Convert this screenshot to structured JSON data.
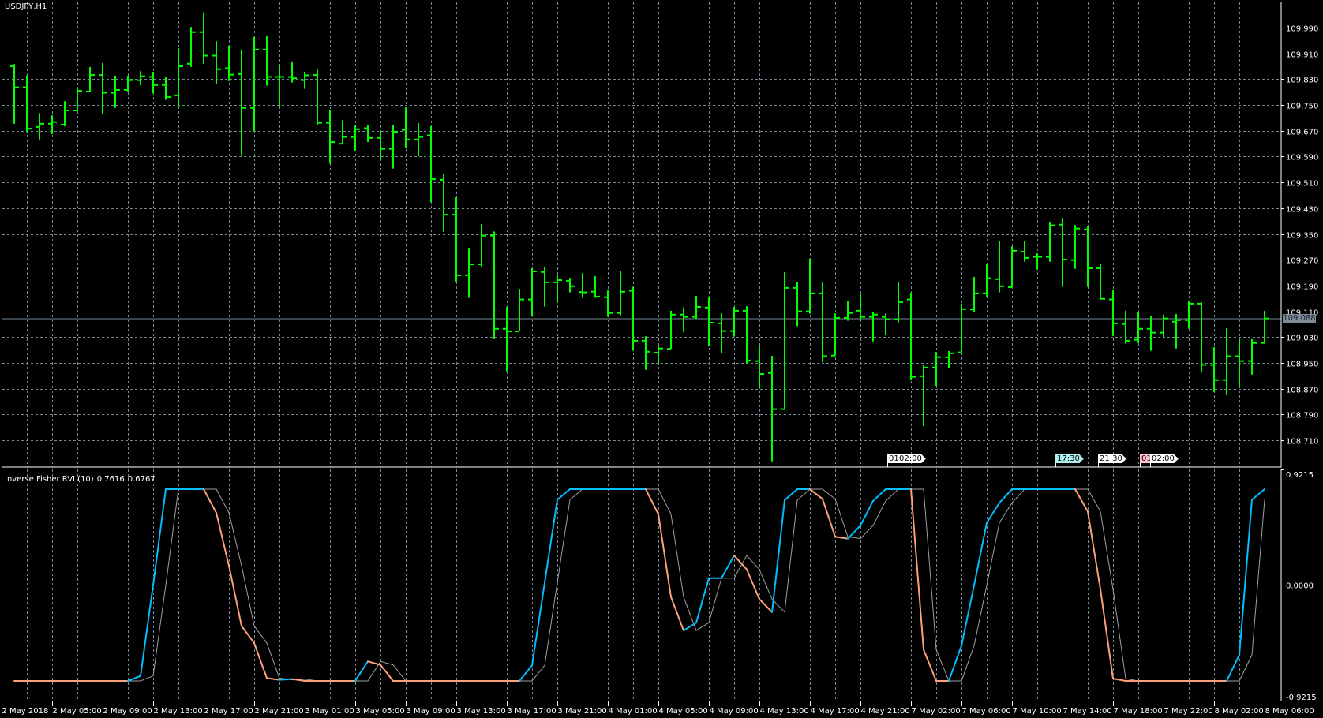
{
  "header": {
    "title": "USDJPY,H1"
  },
  "indicator": {
    "name": "Inverse Fisher RVI (10)",
    "value_main": "0.7616",
    "value_signal": "0.6767"
  },
  "current_price": "109.088",
  "colors": {
    "background": "#000000",
    "bars": "#00FF00",
    "grid": "#778899",
    "main_up": "#00BFFF",
    "main_down": "#FFA07A",
    "signal": "#A0A0A0",
    "axis": "#FFFFFF"
  },
  "markers": [
    {
      "label": "01:",
      "bg": "#FFFFFF"
    },
    {
      "label": "02:00",
      "bg": "#FFFFFF"
    },
    {
      "label": "17:30",
      "bg": "#AFEEEE"
    },
    {
      "label": "21:30",
      "bg": "#FFFFFF"
    },
    {
      "label": "01:",
      "bg": "#FFC0CB"
    },
    {
      "label": "02:00",
      "bg": "#FFFFFF"
    }
  ],
  "chart_data": [
    {
      "type": "ohlc",
      "title": "USDJPY,H1",
      "ylim": [
        108.655,
        110.08
      ],
      "price_ticks": [
        "109.990",
        "109.910",
        "109.830",
        "109.750",
        "109.670",
        "109.590",
        "109.510",
        "109.430",
        "109.350",
        "109.270",
        "109.190",
        "109.110",
        "109.030",
        "108.950",
        "108.870",
        "108.790",
        "108.710"
      ],
      "time_labels": [
        "2 May 2018",
        "2 May 05:00",
        "2 May 09:00",
        "2 May 13:00",
        "2 May 17:00",
        "2 May 21:00",
        "3 May 01:00",
        "3 May 05:00",
        "3 May 09:00",
        "3 May 13:00",
        "3 May 17:00",
        "3 May 21:00",
        "4 May 01:00",
        "4 May 05:00",
        "4 May 09:00",
        "4 May 13:00",
        "4 May 17:00",
        "4 May 21:00",
        "7 May 02:00",
        "7 May 06:00",
        "7 May 10:00",
        "7 May 14:00",
        "7 May 18:00",
        "7 May 22:00",
        "8 May 02:00",
        "8 May 06:00"
      ],
      "grid": true,
      "ohlc_fields": [
        "open",
        "high",
        "low",
        "close"
      ],
      "bars": [
        [
          109.87,
          109.877,
          109.692,
          109.805
        ],
        [
          109.805,
          109.842,
          109.666,
          109.677
        ],
        [
          109.682,
          109.725,
          109.643,
          109.692
        ],
        [
          109.692,
          109.718,
          109.66,
          109.697
        ],
        [
          109.689,
          109.762,
          109.684,
          109.733
        ],
        [
          109.733,
          109.806,
          109.731,
          109.794
        ],
        [
          109.792,
          109.868,
          109.79,
          109.843
        ],
        [
          109.843,
          109.88,
          109.723,
          109.788
        ],
        [
          109.788,
          109.841,
          109.741,
          109.797
        ],
        [
          109.797,
          109.841,
          109.79,
          109.827
        ],
        [
          109.827,
          109.855,
          109.812,
          109.839
        ],
        [
          109.837,
          109.853,
          109.786,
          109.812
        ],
        [
          109.812,
          109.838,
          109.766,
          109.775
        ],
        [
          109.78,
          109.926,
          109.741,
          109.87
        ],
        [
          109.878,
          109.992,
          109.868,
          109.976
        ],
        [
          109.976,
          110.037,
          109.877,
          109.903
        ],
        [
          109.903,
          109.948,
          109.815,
          109.861
        ],
        [
          109.864,
          109.934,
          109.824,
          109.844
        ],
        [
          109.846,
          109.922,
          109.592,
          109.741
        ],
        [
          109.741,
          109.961,
          109.668,
          109.922
        ],
        [
          109.922,
          109.966,
          109.81,
          109.837
        ],
        [
          109.837,
          109.875,
          109.745,
          109.837
        ],
        [
          109.837,
          109.885,
          109.82,
          109.833
        ],
        [
          109.827,
          109.853,
          109.8,
          109.842
        ],
        [
          109.843,
          109.86,
          109.687,
          109.695
        ],
        [
          109.695,
          109.735,
          109.568,
          109.635
        ],
        [
          109.63,
          109.703,
          109.63,
          109.651
        ],
        [
          109.651,
          109.686,
          109.609,
          109.675
        ],
        [
          109.678,
          109.689,
          109.635,
          109.648
        ],
        [
          109.648,
          109.67,
          109.58,
          109.614
        ],
        [
          109.614,
          109.689,
          109.553,
          109.667
        ],
        [
          109.673,
          109.745,
          109.616,
          109.643
        ],
        [
          109.643,
          109.694,
          109.591,
          109.651
        ],
        [
          109.656,
          109.684,
          109.449,
          109.52
        ],
        [
          109.518,
          109.537,
          109.357,
          109.41
        ],
        [
          109.41,
          109.464,
          109.202,
          109.222
        ],
        [
          109.222,
          109.307,
          109.152,
          109.256
        ],
        [
          109.256,
          109.381,
          109.246,
          109.345
        ],
        [
          109.345,
          109.358,
          109.024,
          109.056
        ],
        [
          109.056,
          109.124,
          108.924,
          109.048
        ],
        [
          109.048,
          109.18,
          109.048,
          109.147
        ],
        [
          109.147,
          109.244,
          109.097,
          109.234
        ],
        [
          109.232,
          109.248,
          109.125,
          109.2
        ],
        [
          109.2,
          109.224,
          109.137,
          109.207
        ],
        [
          109.205,
          109.214,
          109.169,
          109.188
        ],
        [
          109.17,
          109.229,
          109.152,
          109.169
        ],
        [
          109.171,
          109.219,
          109.152,
          109.156
        ],
        [
          109.154,
          109.175,
          109.093,
          109.105
        ],
        [
          109.105,
          109.234,
          109.098,
          109.171
        ],
        [
          109.174,
          109.186,
          108.988,
          109.019
        ],
        [
          109.019,
          109.033,
          108.929,
          108.985
        ],
        [
          108.982,
          109.002,
          108.949,
          108.995
        ],
        [
          108.994,
          109.112,
          108.994,
          109.1
        ],
        [
          109.1,
          109.122,
          109.046,
          109.093
        ],
        [
          109.093,
          109.158,
          109.087,
          109.124
        ],
        [
          109.122,
          109.153,
          109.002,
          109.075
        ],
        [
          109.073,
          109.104,
          108.98,
          109.049
        ],
        [
          109.049,
          109.124,
          109.032,
          109.112
        ],
        [
          109.112,
          109.126,
          108.948,
          108.958
        ],
        [
          108.956,
          109.002,
          108.87,
          108.916
        ],
        [
          108.919,
          108.972,
          108.645,
          108.807
        ],
        [
          108.807,
          109.232,
          108.807,
          109.183
        ],
        [
          109.183,
          109.202,
          109.064,
          109.11
        ],
        [
          109.11,
          109.274,
          109.103,
          109.166
        ],
        [
          109.166,
          109.202,
          108.953,
          108.971
        ],
        [
          108.973,
          109.104,
          108.973,
          109.09
        ],
        [
          109.09,
          109.141,
          109.081,
          109.105
        ],
        [
          109.112,
          109.163,
          109.081,
          109.093
        ],
        [
          109.093,
          109.107,
          109.017,
          109.1
        ],
        [
          109.093,
          109.104,
          109.037,
          109.085
        ],
        [
          109.085,
          109.202,
          109.076,
          109.139
        ],
        [
          109.147,
          109.168,
          108.897,
          108.907
        ],
        [
          108.909,
          108.946,
          108.754,
          108.936
        ],
        [
          108.936,
          108.984,
          108.879,
          108.968
        ],
        [
          108.968,
          108.987,
          108.934,
          108.98
        ],
        [
          108.983,
          109.134,
          108.983,
          109.117
        ],
        [
          109.116,
          109.217,
          109.108,
          109.166
        ],
        [
          109.166,
          109.256,
          109.156,
          109.213
        ],
        [
          109.21,
          109.329,
          109.169,
          109.188
        ],
        [
          109.185,
          109.312,
          109.185,
          109.298
        ],
        [
          109.295,
          109.329,
          109.264,
          109.276
        ],
        [
          109.279,
          109.29,
          109.24,
          109.279
        ],
        [
          109.279,
          109.388,
          109.264,
          109.377
        ],
        [
          109.379,
          109.4,
          109.186,
          109.271
        ],
        [
          109.269,
          109.378,
          109.242,
          109.367
        ],
        [
          109.364,
          109.376,
          109.186,
          109.244
        ],
        [
          109.244,
          109.256,
          109.148,
          109.149
        ],
        [
          109.147,
          109.175,
          109.034,
          109.073
        ],
        [
          109.071,
          109.112,
          109.01,
          109.019
        ],
        [
          109.022,
          109.108,
          109.012,
          109.056
        ],
        [
          109.056,
          109.097,
          108.988,
          109.044
        ],
        [
          109.044,
          109.1,
          109.027,
          109.088
        ],
        [
          109.078,
          109.102,
          108.995,
          109.083
        ],
        [
          109.083,
          109.141,
          109.056,
          109.134
        ],
        [
          109.134,
          109.138,
          108.922,
          108.944
        ],
        [
          108.944,
          108.999,
          108.86,
          108.897
        ],
        [
          108.897,
          109.058,
          108.851,
          108.971
        ],
        [
          108.971,
          109.024,
          108.875,
          108.956
        ],
        [
          108.956,
          109.024,
          108.914,
          109.012
        ],
        [
          109.012,
          109.112,
          109.012,
          109.088
        ]
      ]
    },
    {
      "type": "line",
      "title": "Inverse Fisher RVI (10)",
      "ylim": [
        -0.9215,
        0.9215
      ],
      "y_ticks": [
        "0.9215",
        "0.0000",
        "-0.9215"
      ],
      "series": [
        {
          "name": "main",
          "values": [
            -0.7616,
            -0.7616,
            -0.7616,
            -0.7616,
            -0.7616,
            -0.7616,
            -0.7616,
            -0.7616,
            -0.7616,
            -0.7616,
            -0.722,
            0.0,
            0.7616,
            0.7616,
            0.7616,
            0.7616,
            0.574,
            0.154,
            -0.325,
            -0.461,
            -0.739,
            -0.753,
            -0.747,
            -0.7616,
            -0.7616,
            -0.7616,
            -0.7616,
            -0.7616,
            -0.607,
            -0.634,
            -0.7616,
            -0.7616,
            -0.7616,
            -0.7616,
            -0.7616,
            -0.7616,
            -0.7616,
            -0.7616,
            -0.7616,
            -0.7616,
            -0.7616,
            -0.638,
            0.019,
            0.678,
            0.7616,
            0.7616,
            0.7616,
            0.7616,
            0.7616,
            0.7616,
            0.7616,
            0.563,
            -0.095,
            -0.361,
            -0.299,
            0.055,
            0.055,
            0.235,
            0.124,
            -0.112,
            -0.215,
            0.674,
            0.7616,
            0.7616,
            0.684,
            0.384,
            0.369,
            0.473,
            0.668,
            0.7616,
            0.7616,
            0.7616,
            -0.513,
            -0.7616,
            -0.7616,
            -0.481,
            -0.002,
            0.494,
            0.653,
            0.7616,
            0.7616,
            0.7616,
            0.7616,
            0.7616,
            0.7616,
            0.584,
            -0.033,
            -0.743,
            -0.7616,
            -0.7616,
            -0.7616,
            -0.7616,
            -0.7616,
            -0.7616,
            -0.7616,
            -0.7616,
            -0.7616,
            -0.555,
            0.678,
            0.7616
          ]
        },
        {
          "name": "signal",
          "values": [
            -0.7616,
            -0.7616,
            -0.7616,
            -0.7616,
            -0.7616,
            -0.7616,
            -0.7616,
            -0.7616,
            -0.7616,
            -0.7616,
            -0.7616,
            -0.722,
            0.0,
            0.7616,
            0.7616,
            0.7616,
            0.7616,
            0.574,
            0.154,
            -0.325,
            -0.461,
            -0.739,
            -0.753,
            -0.747,
            -0.7616,
            -0.7616,
            -0.7616,
            -0.7616,
            -0.7616,
            -0.607,
            -0.634,
            -0.7616,
            -0.7616,
            -0.7616,
            -0.7616,
            -0.7616,
            -0.7616,
            -0.7616,
            -0.7616,
            -0.7616,
            -0.7616,
            -0.7616,
            -0.638,
            0.019,
            0.678,
            0.7616,
            0.7616,
            0.7616,
            0.7616,
            0.7616,
            0.7616,
            0.7616,
            0.563,
            -0.095,
            -0.361,
            -0.299,
            0.055,
            0.055,
            0.235,
            0.124,
            -0.112,
            -0.215,
            0.674,
            0.7616,
            0.7616,
            0.684,
            0.384,
            0.369,
            0.473,
            0.668,
            0.7616,
            0.7616,
            0.7616,
            -0.513,
            -0.7616,
            -0.7616,
            -0.481,
            -0.002,
            0.494,
            0.653,
            0.7616,
            0.7616,
            0.7616,
            0.7616,
            0.7616,
            0.7616,
            0.584,
            -0.033,
            -0.743,
            -0.7616,
            -0.7616,
            -0.7616,
            -0.7616,
            -0.7616,
            -0.7616,
            -0.7616,
            -0.7616,
            -0.7616,
            -0.555,
            0.6767
          ]
        }
      ]
    }
  ]
}
